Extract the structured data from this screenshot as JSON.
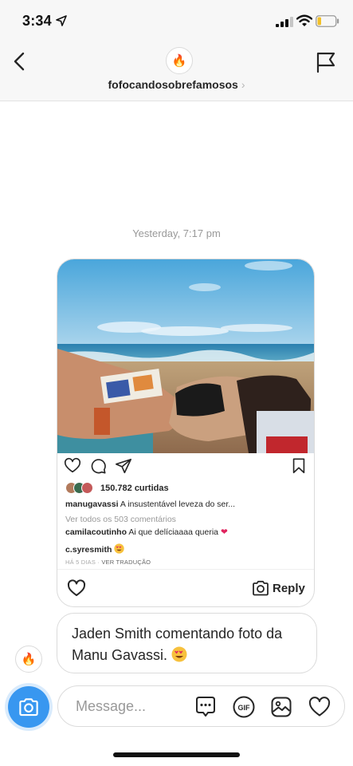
{
  "status_bar": {
    "time": "3:34"
  },
  "header": {
    "avatar_emoji": "🔥",
    "username": "fofocandosobrefamosos",
    "chevron": "›"
  },
  "conversation": {
    "timestamp": "Yesterday, 7:17 pm",
    "shared_post": {
      "likes": "150.782 curtidas",
      "caption_user": "manugavassi",
      "caption_text": "A insustentável leveza do ser...",
      "view_comments": "Ver todos os 503 comentários",
      "comments": [
        {
          "user": "camilacoutinho",
          "text": "Ai que delíciaaaa queria",
          "emoji": "❤"
        },
        {
          "user": "c.syresmith",
          "text": ""
        }
      ],
      "posted_ago": "HÁ 5 DIAS",
      "separator": " · ",
      "see_translation": "VER TRADUÇÃO",
      "reply_label": "Reply"
    },
    "message": {
      "sender_avatar_emoji": "🔥",
      "text": "Jaden Smith comentando foto da Manu Gavassi."
    }
  },
  "composer": {
    "placeholder": "Message..."
  },
  "icons": {
    "back": "chevron-left-icon",
    "flag": "flag-icon",
    "like": "heart-icon",
    "comment": "comment-icon",
    "share": "send-icon",
    "save": "bookmark-icon",
    "camera": "camera-icon",
    "more": "chat-more-icon",
    "gif": "gif-icon",
    "gallery": "image-icon",
    "heart": "heart-icon"
  },
  "colors": {
    "accent": "#3897f0",
    "heart_emoji": "#e0245e"
  }
}
